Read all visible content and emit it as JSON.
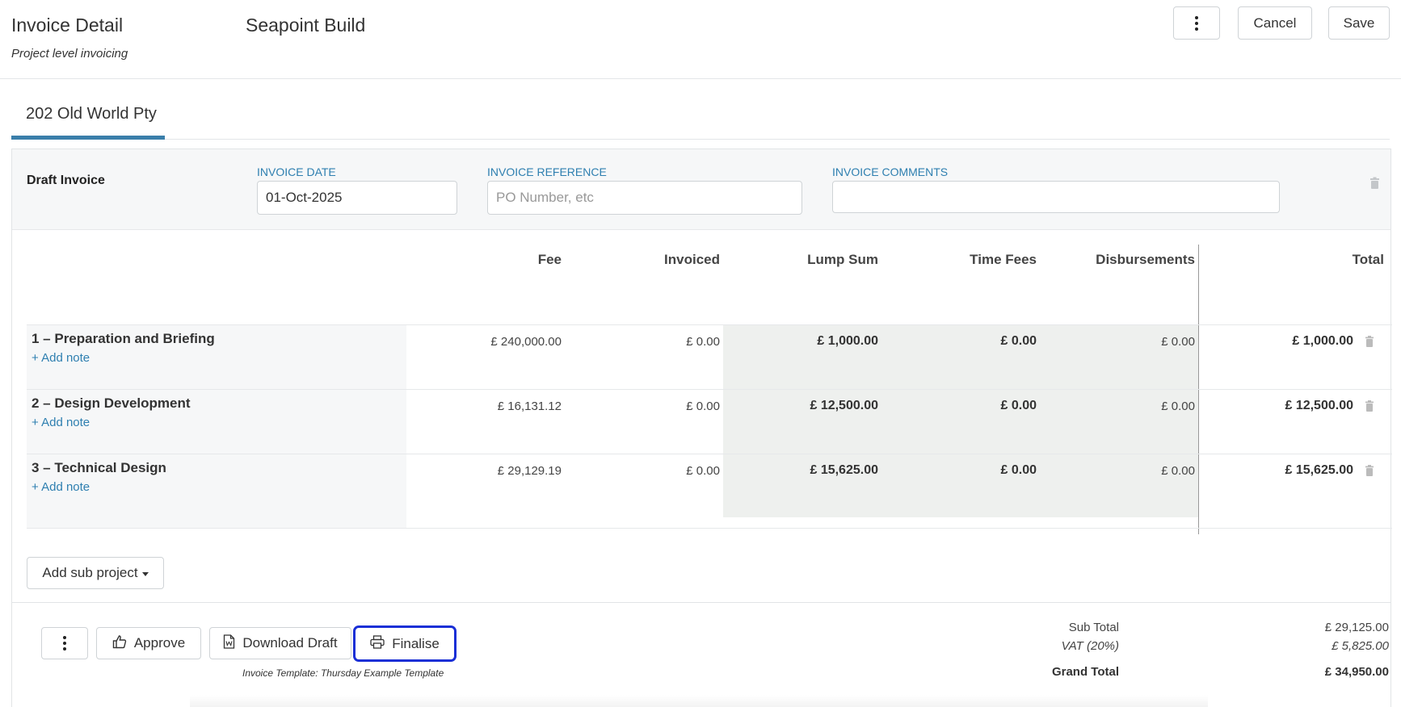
{
  "header": {
    "title": "Invoice Detail",
    "subtitle": "Project level invoicing",
    "project_name": "Seapoint Build",
    "cancel_label": "Cancel",
    "save_label": "Save"
  },
  "tabs": [
    {
      "label": "202 Old World Pty",
      "active": true
    }
  ],
  "invoice": {
    "status_label": "Draft Invoice",
    "date": {
      "label": "INVOICE DATE",
      "value": "01-Oct-2025"
    },
    "reference": {
      "label": "INVOICE REFERENCE",
      "value": "",
      "placeholder": "PO Number, etc"
    },
    "comments": {
      "label": "INVOICE COMMENTS",
      "value": ""
    }
  },
  "table": {
    "columns": [
      "Fee",
      "Invoiced",
      "Lump Sum",
      "Time Fees",
      "Disbursements",
      "Total"
    ],
    "rows": [
      {
        "name": "1 – Preparation and Briefing",
        "note_link": "+ Add note",
        "fee": "£ 240,000.00",
        "invoiced": "£ 0.00",
        "lump_sum": "£ 1,000.00",
        "time_fees": "£ 0.00",
        "disbursements": "£ 0.00",
        "total": "£ 1,000.00"
      },
      {
        "name": "2 – Design Development",
        "note_link": "+ Add note",
        "fee": "£ 16,131.12",
        "invoiced": "£ 0.00",
        "lump_sum": "£ 12,500.00",
        "time_fees": "£ 0.00",
        "disbursements": "£ 0.00",
        "total": "£ 12,500.00"
      },
      {
        "name": "3 – Technical Design",
        "note_link": "+ Add note",
        "fee": "£ 29,129.19",
        "invoiced": "£ 0.00",
        "lump_sum": "£ 15,625.00",
        "time_fees": "£ 0.00",
        "disbursements": "£ 0.00",
        "total": "£ 15,625.00"
      }
    ]
  },
  "add_sub_project_label": "Add sub project",
  "footer": {
    "approve_label": "Approve",
    "download_label": "Download Draft",
    "finalise_label": "Finalise",
    "template_note": "Invoice Template: Thursday Example Template",
    "subtotal_label": "Sub Total",
    "subtotal_value": "£ 29,125.00",
    "vat_label": "VAT (20%)",
    "vat_value": "£ 5,825.00",
    "grand_total_label": "Grand Total",
    "grand_total_value": "£ 34,950.00"
  },
  "colors": {
    "accent": "#2e7fb0",
    "tab_underline": "#3a7eaa",
    "focus_outline": "#1a2fd6",
    "lump_sum_bg": "#eef0ee"
  }
}
